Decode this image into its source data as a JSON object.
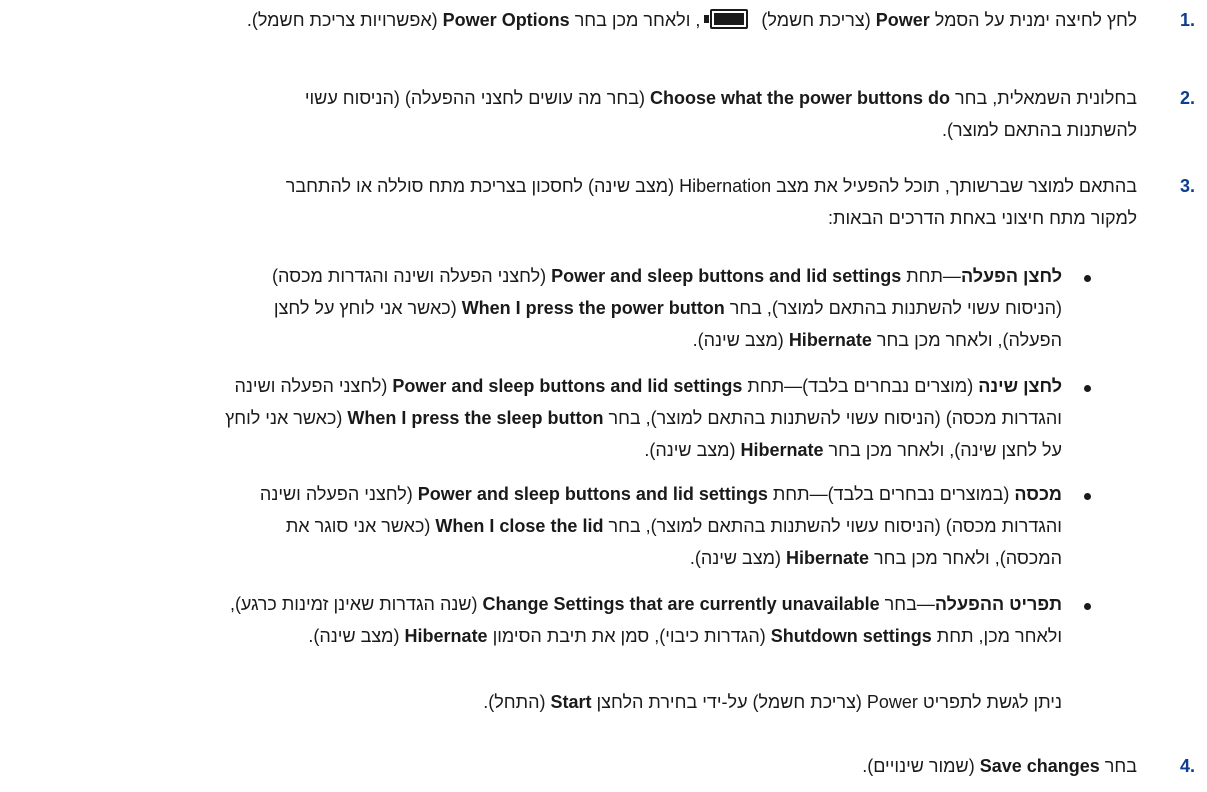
{
  "steps": [
    {
      "number": "1.",
      "lines": [
        [
          {
            "t": "לחץ לחיצה ימנית על הסמל "
          },
          {
            "t": "Power",
            "b": true
          },
          {
            "t": " (צריכת חשמל) "
          },
          {
            "icon": "battery-icon"
          },
          {
            "t": ", ולאחר מכן בחר "
          },
          {
            "t": "Power Options",
            "b": true
          },
          {
            "t": " (אפשרויות צריכת חשמל)."
          }
        ]
      ]
    },
    {
      "number": "2.",
      "lines": [
        [
          {
            "t": "בחלונית השמאלית, בחר "
          },
          {
            "t": "Choose what the power buttons do",
            "b": true
          },
          {
            "t": " (בחר מה עושים לחצני ההפעלה) (הניסוח עשוי"
          }
        ],
        [
          {
            "t": "להשתנות בהתאם למוצר)."
          }
        ]
      ]
    },
    {
      "number": "3.",
      "lines": [
        [
          {
            "t": "בהתאם למוצר שברשותך, תוכל להפעיל את מצב Hibernation (מצב שינה) לחסכון בצריכת מתח סוללה או להתחבר"
          }
        ],
        [
          {
            "t": "למקור מתח חיצוני באחת הדרכים הבאות:"
          }
        ]
      ]
    }
  ],
  "bullets": [
    {
      "lines": [
        [
          {
            "t": "לחצן הפעלה",
            "b": true
          },
          {
            "t": "—תחת "
          },
          {
            "t": "Power and sleep buttons and lid settings",
            "b": true
          },
          {
            "t": " (לחצני הפעלה ושינה והגדרות מכסה)"
          }
        ],
        [
          {
            "t": "(הניסוח עשוי להשתנות בהתאם למוצר), בחר "
          },
          {
            "t": "When I press the power button",
            "b": true
          },
          {
            "t": " (כאשר אני לוחץ על לחצן"
          }
        ],
        [
          {
            "t": "הפעלה), ולאחר מכן בחר "
          },
          {
            "t": "Hibernate",
            "b": true
          },
          {
            "t": " (מצב שינה)."
          }
        ]
      ]
    },
    {
      "lines": [
        [
          {
            "t": "לחצן שינה",
            "b": true
          },
          {
            "t": " (מוצרים נבחרים בלבד)—תחת "
          },
          {
            "t": "Power and sleep buttons and lid settings",
            "b": true
          },
          {
            "t": " (לחצני הפעלה ושינה"
          }
        ],
        [
          {
            "t": "והגדרות מכסה) (הניסוח עשוי להשתנות בהתאם למוצר), בחר "
          },
          {
            "t": "When I press the sleep button",
            "b": true
          },
          {
            "t": " (כאשר אני לוחץ"
          }
        ],
        [
          {
            "t": "על לחצן שינה), ולאחר מכן בחר "
          },
          {
            "t": "Hibernate",
            "b": true
          },
          {
            "t": " (מצב שינה)."
          }
        ]
      ]
    },
    {
      "lines": [
        [
          {
            "t": "מכסה",
            "b": true
          },
          {
            "t": " (במוצרים נבחרים בלבד)—תחת "
          },
          {
            "t": "Power and sleep buttons and lid settings",
            "b": true
          },
          {
            "t": " (לחצני הפעלה ושינה"
          }
        ],
        [
          {
            "t": "והגדרות מכסה) (הניסוח עשוי להשתנות בהתאם למוצר), בחר "
          },
          {
            "t": "When I close the lid",
            "b": true
          },
          {
            "t": " (כאשר אני סוגר את"
          }
        ],
        [
          {
            "t": "המכסה), ולאחר מכן בחר "
          },
          {
            "t": "Hibernate",
            "b": true
          },
          {
            "t": " (מצב שינה)."
          }
        ]
      ]
    },
    {
      "lines": [
        [
          {
            "t": "תפריט ההפעלה",
            "b": true
          },
          {
            "t": "—בחר "
          },
          {
            "t": "Change Settings that are currently unavailable",
            "b": true
          },
          {
            "t": " (שנה הגדרות שאינן זמינות כרגע),"
          }
        ],
        [
          {
            "t": "ולאחר מכן, תחת "
          },
          {
            "t": "Shutdown settings",
            "b": true
          },
          {
            "t": " (הגדרות כיבוי), סמן את תיבת הסימון "
          },
          {
            "t": "Hibernate",
            "b": true
          },
          {
            "t": " (מצב שינה)."
          }
        ]
      ]
    }
  ],
  "note": [
    [
      {
        "t": "ניתן לגשת לתפריט Power (צריכת חשמל) על-ידי בחירת הלחצן "
      },
      {
        "t": "Start",
        "b": true
      },
      {
        "t": " (התחל)."
      }
    ]
  ],
  "step4": {
    "number": "4.",
    "lines": [
      [
        {
          "t": "בחר "
        },
        {
          "t": "Save changes",
          "b": true
        },
        {
          "t": " (שמור שינויים)."
        }
      ]
    ]
  },
  "colors": {
    "number": "#0b3d91",
    "text": "#1a1a1a"
  }
}
